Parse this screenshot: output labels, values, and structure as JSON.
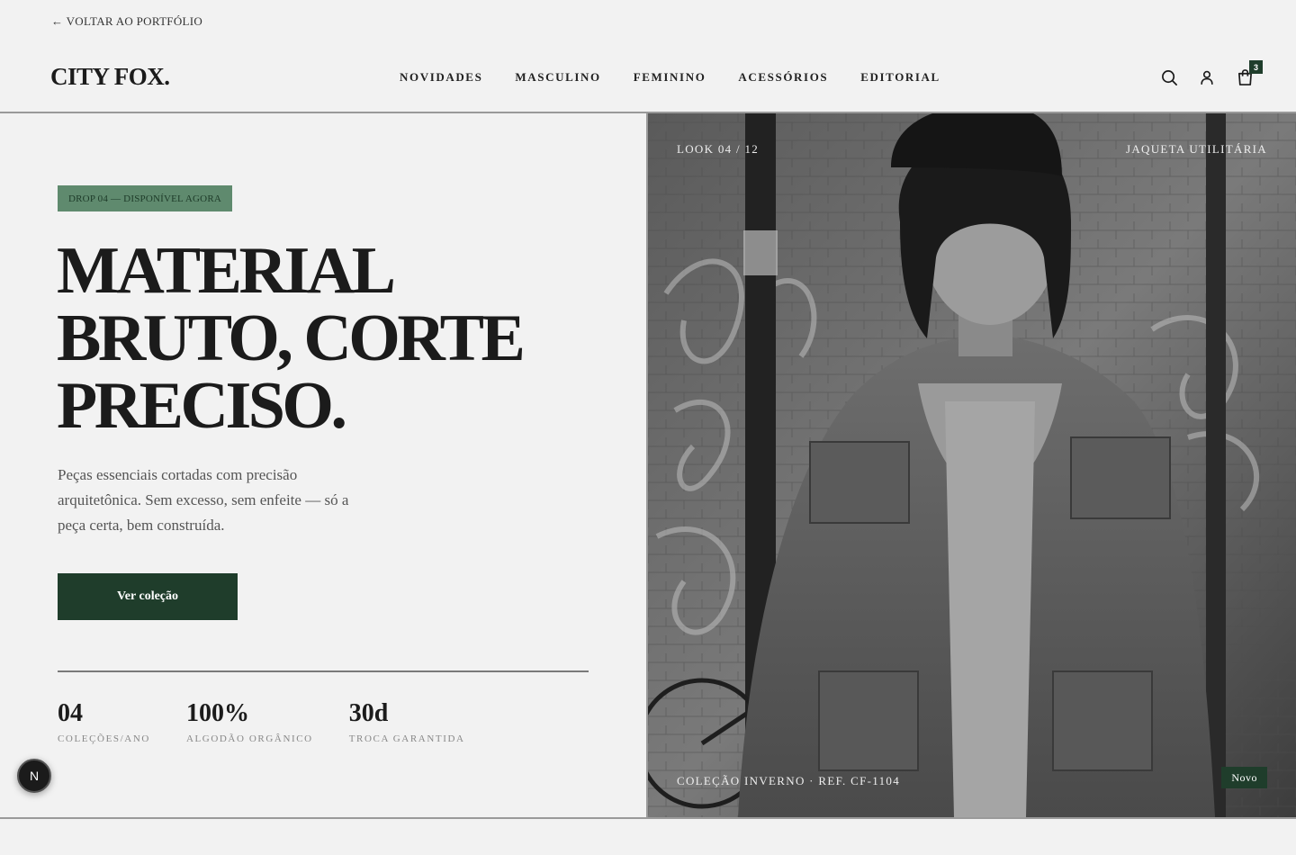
{
  "topbar": {
    "back_label": "← VOLTAR AO PORTFÓLIO"
  },
  "header": {
    "logo": "CITY FOX.",
    "nav": [
      "NOVIDADES",
      "MASCULINO",
      "FEMININO",
      "ACESSÓRIOS",
      "EDITORIAL"
    ],
    "icons": {
      "search": "search-icon",
      "account": "user-icon",
      "cart": "bag-icon"
    },
    "cart_count": "3"
  },
  "hero": {
    "tag": "DROP 04 — DISPONÍVEL AGORA",
    "headline": [
      "MATERIAL",
      "BRUTO, CORTE",
      "PRECISO."
    ],
    "lede": "Peças essenciais cortadas com precisão arquitetônica. Sem excesso, sem enfeite — só a peça certa, bem construída.",
    "cta": "Ver coleção",
    "stats": [
      {
        "value": "04",
        "label": "COLEÇÕES/ANO"
      },
      {
        "value": "100%",
        "label": "ALGODÃO ORGÂNICO"
      },
      {
        "value": "30d",
        "label": "TROCA GARANTIDA"
      }
    ]
  },
  "image": {
    "look": "LOOK 04 / 12",
    "product": "JAQUETA UTILITÁRIA",
    "caption": "COLEÇÃO INVERNO · REF. CF-1104",
    "badge": "Novo"
  },
  "fab": {
    "label": "N"
  },
  "colors": {
    "accent": "#1f3d2b",
    "tag_bg": "#5f8a6e",
    "background": "#f2f2f2",
    "text": "#1b1b1b"
  }
}
